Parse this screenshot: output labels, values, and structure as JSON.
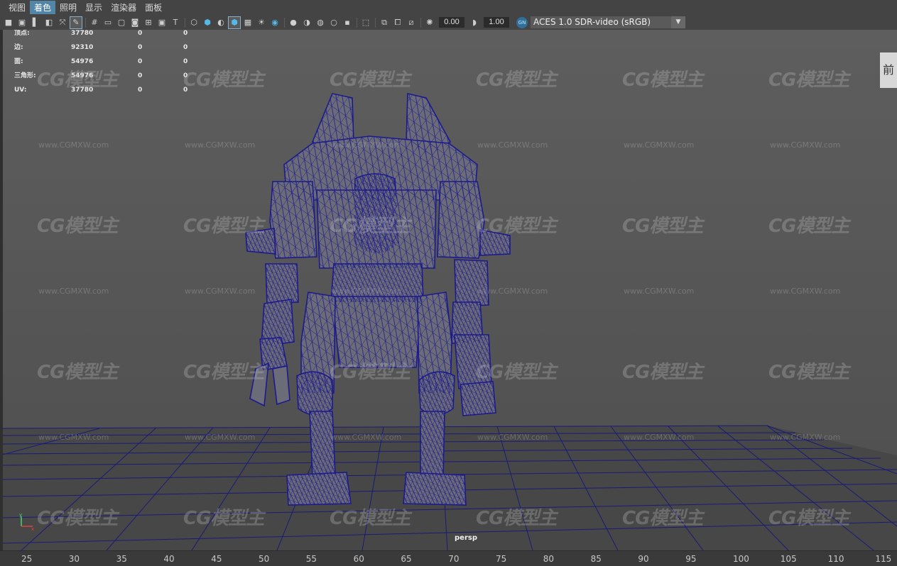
{
  "menubar": {
    "items": [
      {
        "label": "视图",
        "active": false
      },
      {
        "label": "着色",
        "active": true
      },
      {
        "label": "照明",
        "active": false
      },
      {
        "label": "显示",
        "active": false
      },
      {
        "label": "渲染器",
        "active": false
      },
      {
        "label": "面板",
        "active": false
      }
    ]
  },
  "toolbar": {
    "exposure_value": "0.00",
    "gamma_value": "1.00",
    "colorspace_badge": "GN",
    "colorspace_select": "ACES 1.0 SDR-video (sRGB)"
  },
  "hud": {
    "rows": [
      {
        "label": "顶点:",
        "v1": "37780",
        "v2": "0",
        "v3": "0"
      },
      {
        "label": "边:",
        "v1": "92310",
        "v2": "0",
        "v3": "0"
      },
      {
        "label": "面:",
        "v1": "54976",
        "v2": "0",
        "v3": "0"
      },
      {
        "label": "三角形:",
        "v1": "54976",
        "v2": "0",
        "v3": "0"
      },
      {
        "label": "UV:",
        "v1": "37780",
        "v2": "0",
        "v3": "0"
      }
    ]
  },
  "viewport": {
    "camera_label": "persp",
    "side_tab": "前",
    "wireframe_color": "#1c1a8c",
    "grid_color": "#1a1a78",
    "background_color": "#5d5d5d"
  },
  "watermark": {
    "logo": "CG模型主",
    "url": "www.CGMXW.com"
  },
  "timeline": {
    "ticks": [
      "25",
      "30",
      "35",
      "40",
      "45",
      "50",
      "55",
      "60",
      "65",
      "70",
      "75",
      "80",
      "85",
      "90",
      "95",
      "100",
      "105",
      "110",
      "115"
    ]
  }
}
